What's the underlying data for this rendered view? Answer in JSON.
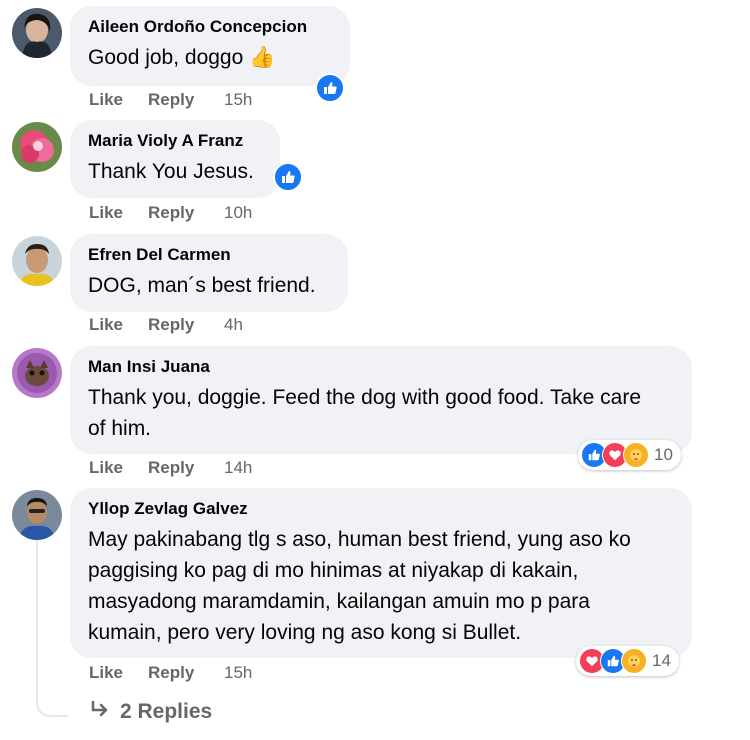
{
  "comments": [
    {
      "author": "Aileen Ordoño Concepcion",
      "text": "Good job, doggo 👍",
      "like": "Like",
      "reply": "Reply",
      "time": "15h",
      "reactions": [
        "like"
      ]
    },
    {
      "author": "Maria Violy A Franz",
      "text": "Thank You Jesus.",
      "like": "Like",
      "reply": "Reply",
      "time": "10h",
      "reactions": [
        "like"
      ]
    },
    {
      "author": "Efren Del Carmen",
      "text": "DOG, man´s best friend.",
      "like": "Like",
      "reply": "Reply",
      "time": "4h",
      "reactions": []
    },
    {
      "author": "Man Insi Juana",
      "text": "Thank you, doggie. Feed the dog with good food. Take care of him.",
      "like": "Like",
      "reply": "Reply",
      "time": "14h",
      "reactions": [
        "like",
        "love",
        "care"
      ],
      "reaction_count": "10"
    },
    {
      "author": "Yllop Zevlag Galvez",
      "text": "May pakinabang tlg s aso, human best friend, yung aso ko paggising ko pag di mo hinimas at niyakap di kakain, masyadong maramdamin, kailangan amuin mo p para kumain, pero very loving ng aso kong si Bullet.",
      "like": "Like",
      "reply": "Reply",
      "time": "15h",
      "reactions": [
        "love",
        "like",
        "care"
      ],
      "reaction_count": "14"
    }
  ],
  "replies_link": "2 Replies",
  "colors": {
    "bubble": "#f0f2f5",
    "action_text": "#65676b",
    "like_blue": "#1877f2",
    "love_red": "#f33e58",
    "care_yellow": "#f7b125"
  },
  "icons": {
    "like": "thumbs-up-icon",
    "love": "heart-icon",
    "care": "care-hug-icon",
    "reply_arrow": "reply-arrow-icon"
  }
}
